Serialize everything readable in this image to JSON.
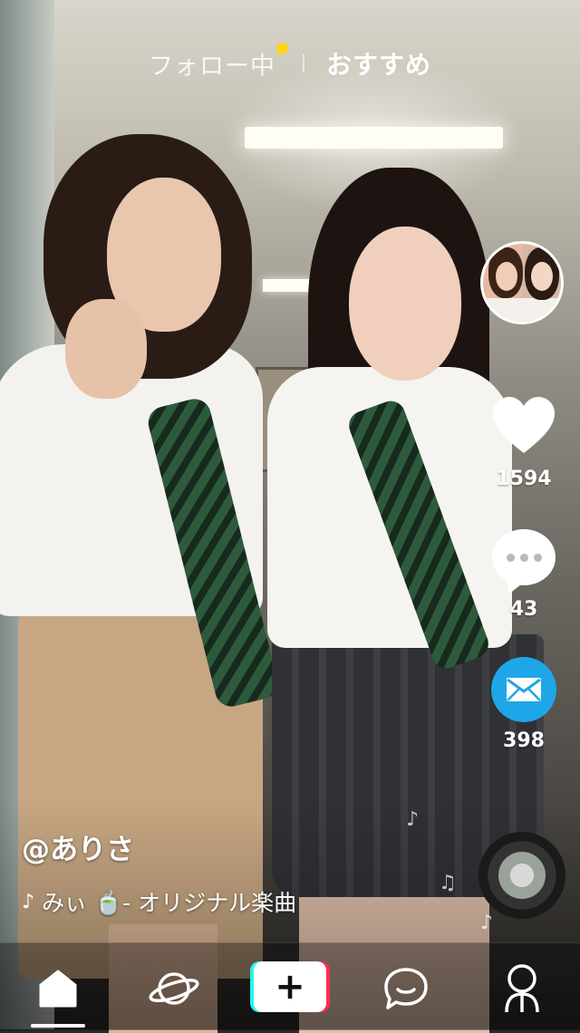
{
  "top_tabs": {
    "following": "フォロー中",
    "recommended": "おすすめ",
    "following_dot_color": "#ffd21c"
  },
  "actions": {
    "likes": "1594",
    "comments": "43",
    "shares": "398",
    "share_color": "#1fa6e8"
  },
  "caption": {
    "username": "@ありさ",
    "music_icon": "♪",
    "music_text": "みぃ 🍵- オリジナル楽曲"
  },
  "bottom_nav": {
    "items": [
      "home-icon",
      "discover-icon",
      "create-icon",
      "inbox-icon",
      "profile-icon"
    ],
    "create_symbol": "+",
    "active": "home-icon"
  }
}
